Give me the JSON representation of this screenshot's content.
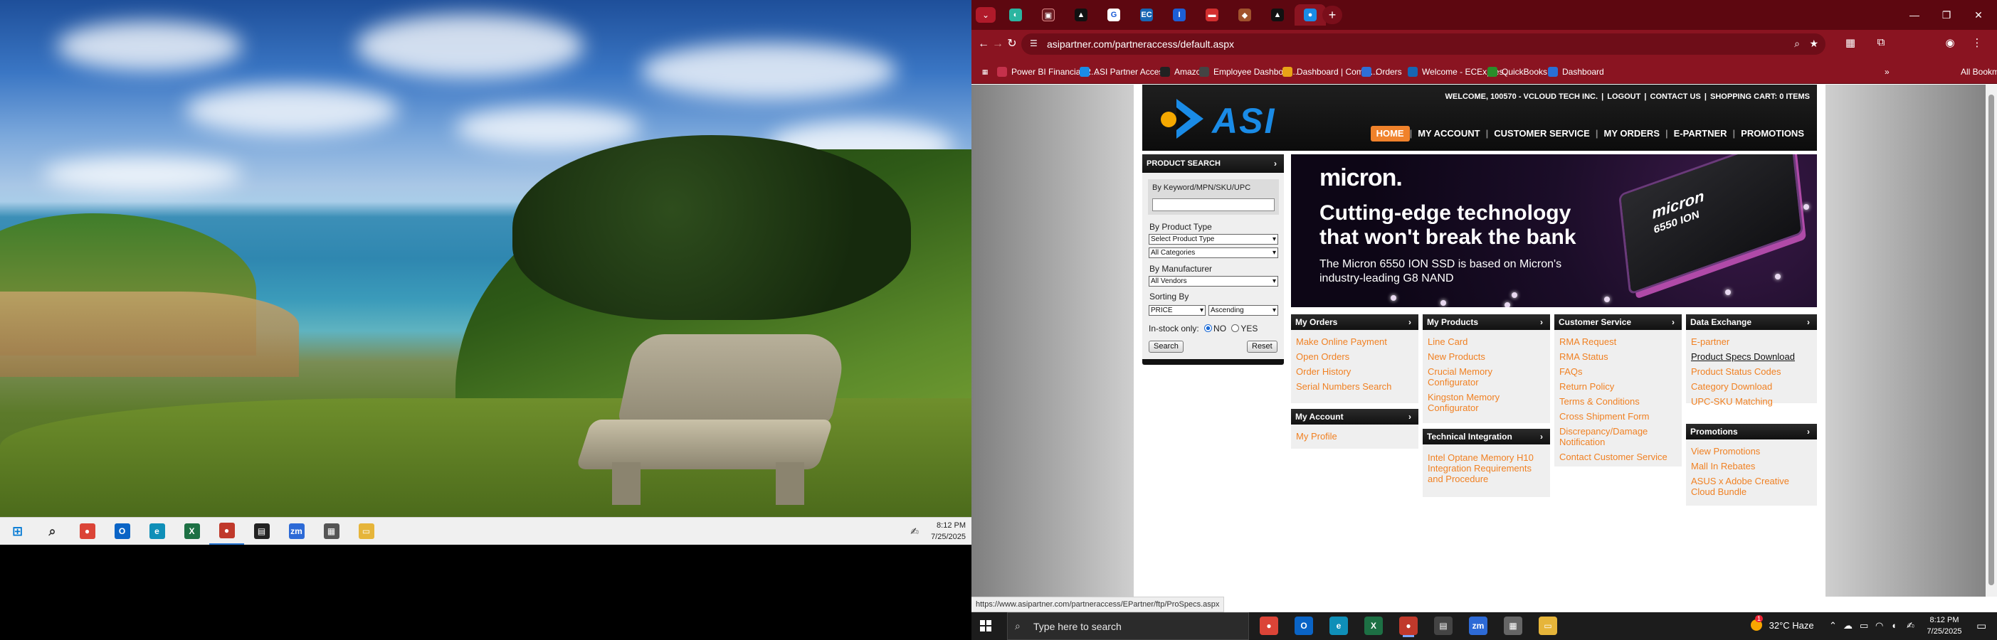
{
  "left_monitor": {
    "taskbar": {
      "icons": [
        {
          "name": "windows-start-icon",
          "glyph": "⊞",
          "color": "#0078d4"
        },
        {
          "name": "search-icon",
          "glyph": "⌕",
          "color": "#333333"
        },
        {
          "name": "chrome-icon",
          "glyph": "●",
          "color": "#db4437"
        },
        {
          "name": "outlook-icon",
          "glyph": "O",
          "color": "#0a64c6"
        },
        {
          "name": "edge-icon",
          "glyph": "e",
          "color": "#0f8fb8"
        },
        {
          "name": "excel-icon",
          "glyph": "X",
          "color": "#1d7044"
        },
        {
          "name": "chrome-profile-icon",
          "glyph": "●",
          "color": "#c0392b"
        },
        {
          "name": "sticky-notes-icon",
          "glyph": "▤",
          "color": "#222222"
        },
        {
          "name": "zoom-icon",
          "glyph": "zm",
          "color": "#2d6ad6"
        },
        {
          "name": "calculator-icon",
          "glyph": "▦",
          "color": "#555555"
        },
        {
          "name": "file-explorer-icon",
          "glyph": "▭",
          "color": "#e6b53a"
        }
      ],
      "time": "8:12 PM",
      "date": "7/25/2025"
    }
  },
  "browser": {
    "url": "asipartner.com/partneraccess/default.aspx",
    "bookmarks": [
      {
        "label": "",
        "icon": "apps-grid-icon",
        "color": "#8a1421"
      },
      {
        "label": "Power BI Financial R...",
        "icon": "power-bi-icon",
        "color": "#c4314b"
      },
      {
        "label": "ASI Partner Access",
        "icon": "asi-icon",
        "color": "#1a8be6"
      },
      {
        "label": "Amazon",
        "icon": "amazon-icon",
        "color": "#222222"
      },
      {
        "label": "Employee Dashboar...",
        "icon": "employee-dashboard-icon",
        "color": "#444444"
      },
      {
        "label": "Dashboard | Comta...",
        "icon": "comtax-icon",
        "color": "#e8a317"
      },
      {
        "label": "Orders",
        "icon": "orders-icon",
        "color": "#2f6fd6"
      },
      {
        "label": "Welcome - ECExpres...",
        "icon": "ecexpress-icon",
        "color": "#1766b4"
      },
      {
        "label": "QuickBooks",
        "icon": "quickbooks-icon",
        "color": "#2a8c2a"
      },
      {
        "label": "Dashboard",
        "icon": "dashboard-icon",
        "color": "#2a6fd6"
      },
      {
        "label": "All Bookmarks",
        "icon": "folder-icon",
        "color": "#8a1421"
      }
    ],
    "status_url": "https://www.asipartner.com/partneraccess/EPartner/ftp/ProSpecs.aspx"
  },
  "site": {
    "header_links": [
      "WELCOME, 100570 - VCLOUD TECH INC.",
      "LOGOUT",
      "CONTACT US",
      "SHOPPING CART: 0 ITEMS"
    ],
    "logo_text": "ASI",
    "nav": [
      "HOME",
      "MY ACCOUNT",
      "CUSTOMER SERVICE",
      "MY ORDERS",
      "E-PARTNER",
      "PROMOTIONS"
    ],
    "product_search": {
      "title": "PRODUCT SEARCH",
      "keyword_label": "By Keyword/MPN/SKU/UPC",
      "keyword_value": "",
      "product_type_label": "By Product Type",
      "product_type_value": "Select Product Type",
      "category_value": "All Categories",
      "manufacturer_label": "By Manufacturer",
      "manufacturer_value": "All Vendors",
      "sorting_label": "Sorting By",
      "sort_field": "PRICE",
      "sort_order": "Ascending",
      "instock_label": "In-stock only:",
      "instock_no": "NO",
      "instock_yes": "YES",
      "search_button": "Search",
      "reset_button": "Reset"
    },
    "banner": {
      "brand": "micron.",
      "headline_1": "Cutting-edge technology",
      "headline_2": "that won't break the bank",
      "sub_1": "The Micron 6550 ION SSD is based on Micron's",
      "sub_2": "industry-leading G8 NAND",
      "ssd_brand": "micron",
      "ssd_model": "6550 ION"
    },
    "boxes": {
      "my_orders": {
        "title": "My Orders",
        "links": [
          "Make Online Payment",
          "Open Orders",
          "Order History",
          "Serial Numbers Search"
        ]
      },
      "my_account": {
        "title": "My Account",
        "links": [
          "My Profile"
        ]
      },
      "my_products": {
        "title": "My Products",
        "links": [
          "Line Card",
          "New Products",
          "Crucial Memory",
          "Configurator",
          "Kingston Memory",
          "Configurator"
        ]
      },
      "technical": {
        "title": "Technical Integration",
        "links": [
          "Intel Optane Memory H10",
          "Integration Requirements",
          "and Procedure"
        ]
      },
      "customer_service": {
        "title": "Customer Service",
        "links": [
          "RMA Request",
          "RMA Status",
          "FAQs",
          "Return Policy",
          "Terms & Conditions",
          "Cross Shipment Form",
          "Discrepancy/Damage",
          "Notification",
          "Contact Customer Service"
        ]
      },
      "data_exchange": {
        "title": "Data Exchange",
        "links": [
          "E-partner",
          "Product Specs Download",
          "Product Status Codes",
          "Category Download",
          "UPC-SKU Matching"
        ]
      },
      "promotions": {
        "title": "Promotions",
        "links": [
          "View Promotions",
          "Mall In Rebates",
          "ASUS x Adobe Creative",
          "Cloud Bundle"
        ]
      }
    }
  },
  "right_taskbar": {
    "search_placeholder": "Type here to search",
    "apps": [
      {
        "name": "chrome-icon",
        "glyph": "●",
        "color": "#db4437"
      },
      {
        "name": "outlook-icon",
        "glyph": "O",
        "color": "#0a64c6"
      },
      {
        "name": "edge-icon",
        "glyph": "e",
        "color": "#0f8fb8"
      },
      {
        "name": "excel-icon",
        "glyph": "X",
        "color": "#1d7044"
      },
      {
        "name": "chrome-profile-icon",
        "glyph": "●",
        "color": "#c0392b"
      },
      {
        "name": "sticky-notes-icon",
        "glyph": "▤",
        "color": "#444444"
      },
      {
        "name": "zoom-icon",
        "glyph": "zm",
        "color": "#2d6ad6"
      },
      {
        "name": "calculator-icon",
        "glyph": "▦",
        "color": "#666666"
      },
      {
        "name": "file-explorer-icon",
        "glyph": "▭",
        "color": "#e6b53a"
      }
    ],
    "weather_temp": "32°C",
    "weather_desc": "Haze",
    "weather_badge": "1",
    "time": "8:12 PM",
    "date": "7/25/2025"
  }
}
